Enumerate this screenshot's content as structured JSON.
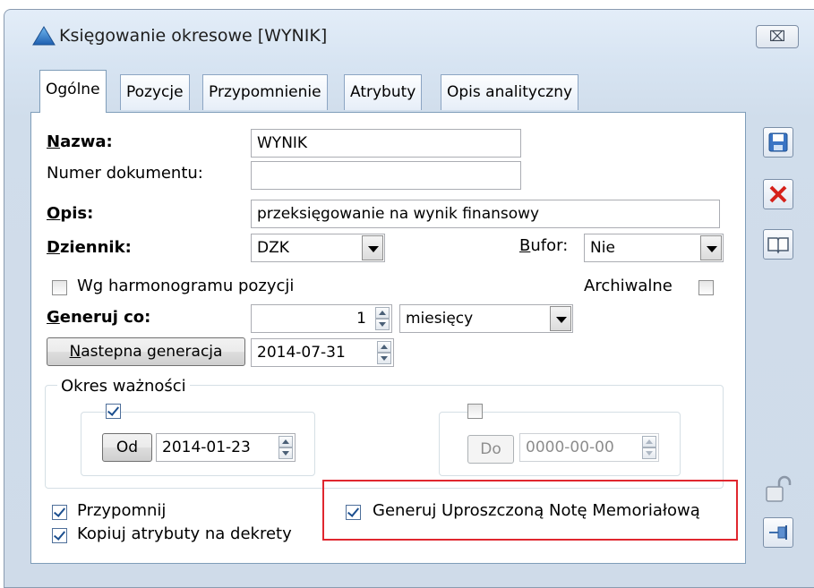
{
  "window": {
    "title": "Księgowanie okresowe [WYNIK]",
    "close_glyph": "⌧"
  },
  "tabs": [
    {
      "label": "Ogólne",
      "active": true
    },
    {
      "label": "Pozycje",
      "active": false
    },
    {
      "label": "Przypomnienie",
      "active": false
    },
    {
      "label": "Atrybuty",
      "active": false
    },
    {
      "label": "Opis analityczny",
      "active": false
    }
  ],
  "form": {
    "nazwa_label": "Nazwa:",
    "nazwa_value": "WYNIK",
    "numer_label": "Numer dokumentu:",
    "numer_value": "",
    "opis_label": "Opis:",
    "opis_value": "przeksięgowanie na wynik finansowy",
    "dziennik_label": "Dziennik:",
    "dziennik_value": "DZK",
    "bufor_label": "Bufor:",
    "bufor_value": "Nie",
    "wg_harmonogramu_label": "Wg harmonogramu pozycji",
    "wg_harmonogramu_checked": false,
    "archiwalne_label": "Archiwalne",
    "archiwalne_checked": false,
    "generuj_co_label": "Generuj co:",
    "generuj_co_value": "1",
    "generuj_co_unit": "miesięcy",
    "nastepna_button": "Nastepna generacja",
    "nastepna_value": "2014-07-31"
  },
  "okres": {
    "title": "Okres ważności",
    "od_checked": true,
    "od_button": "Od",
    "od_value": "2014-01-23",
    "do_checked": false,
    "do_button": "Do",
    "do_value": "0000-00-00"
  },
  "bottom": {
    "przypomnij_label": "Przypomnij",
    "przypomnij_checked": true,
    "kopiuj_label": "Kopiuj atrybuty na dekrety",
    "kopiuj_checked": true,
    "generuj_nota_label": "Generuj Uproszczoną Notę Memoriałową",
    "generuj_nota_checked": true
  },
  "icons": {
    "save": "save-icon",
    "cancel": "cancel-icon",
    "help": "book-icon",
    "lock": "padlock-icon",
    "pin": "pin-icon",
    "app": "triangle-app-icon"
  },
  "colors": {
    "highlight": "#e0272f",
    "cancel_red": "#d6211a",
    "check_blue": "#1c4f8f"
  }
}
